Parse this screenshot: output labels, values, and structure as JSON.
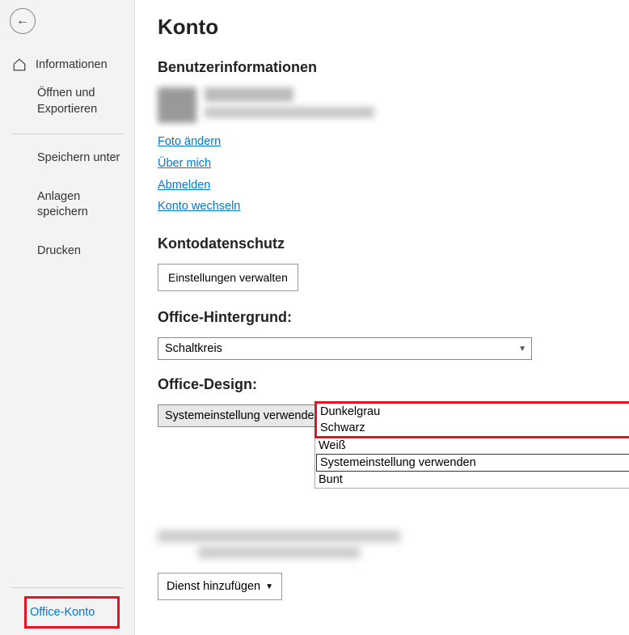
{
  "sidebar": {
    "items": [
      {
        "label": "Informationen"
      },
      {
        "label": "Öffnen und Exportieren"
      },
      {
        "label": "Speichern unter"
      },
      {
        "label": "Anlagen speichern"
      },
      {
        "label": "Drucken"
      }
    ],
    "office_account": "Office-Konto"
  },
  "page": {
    "title": "Konto"
  },
  "user_info": {
    "heading": "Benutzerinformationen",
    "links": {
      "change_photo": "Foto ändern",
      "about_me": "Über mich",
      "sign_out": "Abmelden",
      "switch_account": "Konto wechseln"
    }
  },
  "privacy": {
    "heading": "Kontodatenschutz",
    "button": "Einstellungen verwalten"
  },
  "background": {
    "heading": "Office-Hintergrund:",
    "selected": "Schaltkreis"
  },
  "theme": {
    "heading": "Office-Design:",
    "selected": "Systemeinstellung verwenden",
    "options": [
      "Dunkelgrau",
      "Schwarz",
      "Weiß",
      "Systemeinstellung verwenden",
      "Bunt"
    ]
  },
  "service": {
    "button": "Dienst hinzufügen"
  }
}
